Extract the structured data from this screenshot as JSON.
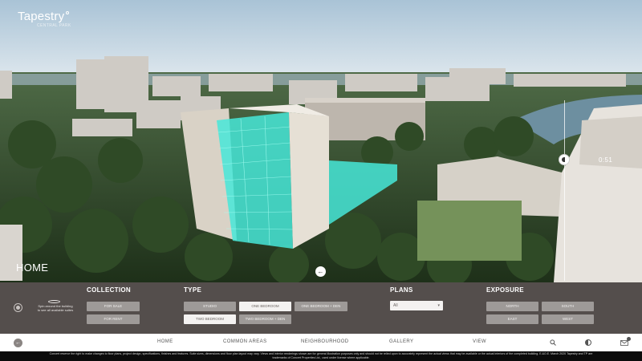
{
  "brand": {
    "name": "Tapestry",
    "subtitle": "CENTRAL PARK"
  },
  "scene": {
    "title": "HOME",
    "time_readout": "0:51",
    "prev_glyph": "←"
  },
  "rotate_hint": "Spin around the building to see all available suites",
  "filters": {
    "collection": {
      "title": "COLLECTION",
      "options": [
        "FOR SALE",
        "FOR RENT"
      ]
    },
    "type": {
      "title": "TYPE",
      "options": [
        "STUDIO",
        "ONE BEDROOM",
        "ONE BEDROOM + DEN",
        "TWO BEDROOM",
        "TWO BEDROOM + DEN"
      ],
      "active": [
        "ONE BEDROOM",
        "TWO BEDROOM"
      ]
    },
    "plans": {
      "title": "PLANS",
      "selected": "All"
    },
    "exposure": {
      "title": "EXPOSURE",
      "options": [
        "NORTH",
        "SOUTH",
        "EAST",
        "WEST"
      ]
    }
  },
  "nav": {
    "back_glyph": "←",
    "items": [
      "HOME",
      "COMMON AREAS",
      "NEIGHBOURHOOD",
      "GALLERY",
      "VIEW"
    ]
  },
  "disclaimer": "Concert reserve the right to make changes to floor plans, project design, specifications, finishes and features. Suite sizes, dimensions and floor plan layout may vary. Views and interior renderings shown are for general illustration purposes only and should not be relied upon to accurately represent the actual views that may be available or the actual interiors of the completed building. E.&O.E. March 2020 Tapestry and TP are trademarks of Concert Properties Ltd., used under license where applicable.",
  "colors": {
    "highlight": "#46e8d8",
    "panel": "#56504e",
    "chip": "#9e9a98",
    "chip_active": "#f4f2f1"
  }
}
